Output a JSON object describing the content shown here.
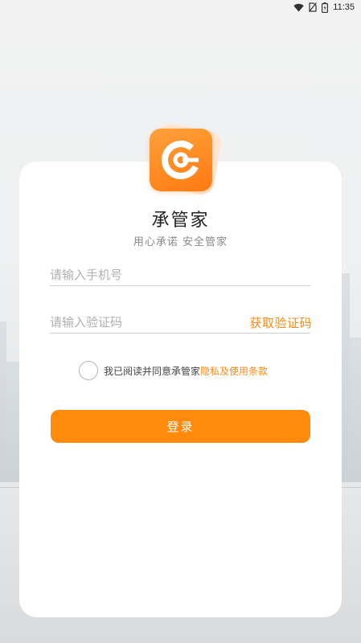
{
  "status_bar": {
    "time": "11:35",
    "icons": [
      "wifi-icon",
      "no-sim-icon",
      "battery-icon"
    ]
  },
  "app": {
    "logo_icon": "app-logo-icon",
    "title": "承管家",
    "slogan": "用心承诺  安全管家"
  },
  "form": {
    "phone_placeholder": "请输入手机号",
    "code_placeholder": "请输入验证码",
    "get_code_label": "获取验证码",
    "agreement_text": "我已阅读并同意承管家",
    "agreement_link": "隐私及使用条款",
    "login_label": "登录"
  },
  "colors": {
    "accent": "#ff8a0b",
    "link": "#ff8a13"
  }
}
